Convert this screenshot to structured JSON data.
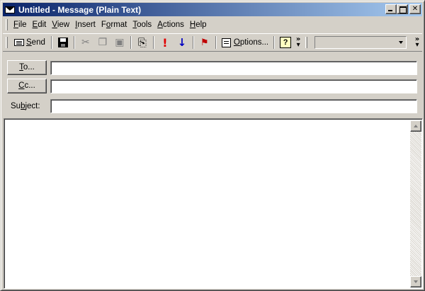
{
  "window": {
    "title": "Untitled - Message (Plain Text)"
  },
  "menu": [
    {
      "pre": "",
      "u": "F",
      "post": "ile"
    },
    {
      "pre": "",
      "u": "E",
      "post": "dit"
    },
    {
      "pre": "",
      "u": "V",
      "post": "iew"
    },
    {
      "pre": "",
      "u": "I",
      "post": "nsert"
    },
    {
      "pre": "F",
      "u": "o",
      "post": "rmat"
    },
    {
      "pre": "",
      "u": "T",
      "post": "ools"
    },
    {
      "pre": "",
      "u": "A",
      "post": "ctions"
    },
    {
      "pre": "",
      "u": "H",
      "post": "elp"
    }
  ],
  "toolbar": {
    "send_pre": "",
    "send_u": "S",
    "send_post": "end",
    "options_pre": "",
    "options_u": "O",
    "options_post": "ptions...",
    "help_glyph": "?",
    "overflow_glyph": "»",
    "dropdown_value": ""
  },
  "address": {
    "to_pre": "",
    "to_u": "T",
    "to_post": "o...",
    "cc_pre": "",
    "cc_u": "C",
    "cc_post": "c...",
    "subject_pre": "Su",
    "subject_u": "b",
    "subject_post": "ject:",
    "to_value": "",
    "cc_value": "",
    "subject_value": ""
  },
  "body": {
    "text": ""
  },
  "colors": {
    "titlebar_start": "#0a246a",
    "titlebar_end": "#a6caf0",
    "face": "#d4d0c8"
  },
  "icons": {
    "send": "send-icon",
    "save": "save-icon",
    "cut": "cut-icon",
    "copy": "copy-icon",
    "paste": "paste-icon",
    "attach": "paperclip-icon",
    "importance_high": "exclamation-icon",
    "importance_low": "down-arrow-icon",
    "flag": "flag-icon",
    "options": "options-icon",
    "help": "help-icon"
  }
}
